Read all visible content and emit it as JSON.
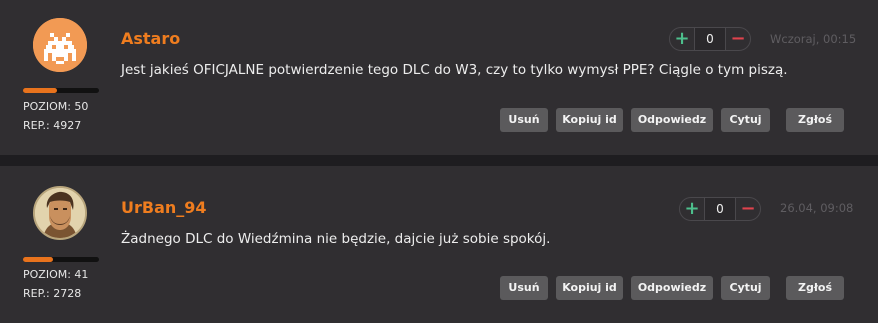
{
  "comments": [
    {
      "author": "Astaro",
      "avatar_icon": "space-invader-icon",
      "level_label": "POZIOM: 50",
      "rep_label": "REP.: 4927",
      "level_progress": 0.45,
      "text": "Jest jakieś OFICJALNE potwierdzenie tego DLC do W3, czy to tylko wymysł PPE? Ciągle o tym piszą.",
      "votes": "0",
      "date": "Wczoraj, 00:15",
      "actions": [
        "Usuń",
        "Kopiuj id",
        "Odpowiedz",
        "Cytuj",
        "Zgłoś"
      ]
    },
    {
      "author": "UrBan_94",
      "avatar_icon": "bearded-man-portrait-icon",
      "level_label": "POZIOM: 41",
      "rep_label": "REP.: 2728",
      "level_progress": 0.4,
      "text": "Żadnego DLC do Wiedźmina nie będzie, dajcie już sobie spokój.",
      "votes": "0",
      "date": "26.04, 09:08",
      "actions": [
        "Usuń",
        "Kopiuj id",
        "Odpowiedz",
        "Cytuj",
        "Zgłoś"
      ]
    }
  ],
  "colors": {
    "author": "#ef7d1f",
    "progress": "#e8731d",
    "plus": "#4dbf8c",
    "minus": "#e0434d"
  }
}
